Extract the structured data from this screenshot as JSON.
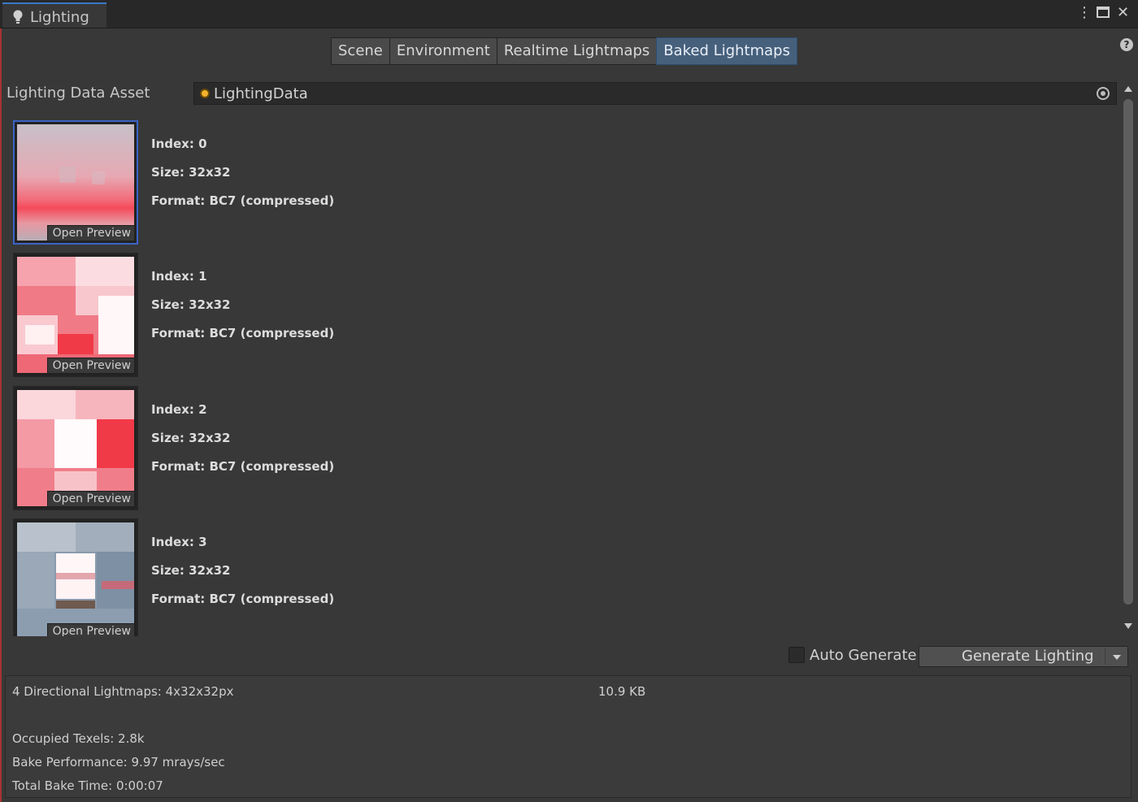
{
  "window": {
    "tab_title": "Lighting",
    "tab_icon": "lightbulb-icon",
    "controls": {
      "menu": "⋮",
      "maximize": "🗖",
      "close": "✕"
    }
  },
  "toolbar": {
    "tabs": [
      {
        "label": "Scene",
        "active": false
      },
      {
        "label": "Environment",
        "active": false
      },
      {
        "label": "Realtime Lightmaps",
        "active": false
      },
      {
        "label": "Baked Lightmaps",
        "active": true
      }
    ],
    "help": "?"
  },
  "lighting_data_asset": {
    "label": "Lighting Data Asset",
    "value": "LightingData",
    "value_icon": "lighting-data-asset-icon",
    "picker_icon": "object-picker-icon"
  },
  "lightmaps": [
    {
      "index": "Index: 0",
      "size": "Size: 32x32",
      "format": "Format: BC7 (compressed)",
      "preview": "Open Preview",
      "selected": true
    },
    {
      "index": "Index: 1",
      "size": "Size: 32x32",
      "format": "Format: BC7 (compressed)",
      "preview": "Open Preview",
      "selected": false
    },
    {
      "index": "Index: 2",
      "size": "Size: 32x32",
      "format": "Format: BC7 (compressed)",
      "preview": "Open Preview",
      "selected": false
    },
    {
      "index": "Index: 3",
      "size": "Size: 32x32",
      "format": "Format: BC7 (compressed)",
      "preview": "Open Preview",
      "selected": false
    }
  ],
  "bottom": {
    "auto_generate_label": "Auto Generate",
    "auto_generate_checked": false,
    "generate_button": "Generate Lighting"
  },
  "stats": {
    "lightmaps_summary": "4 Directional Lightmaps: 4x32x32px",
    "size": "10.9 KB",
    "occupied_texels": "Occupied Texels: 2.8k",
    "bake_performance": "Bake Performance: 9.97 mrays/sec",
    "total_bake_time": "Total Bake Time: 0:00:07"
  },
  "colors": {
    "accent": "#3b64c8",
    "active_tab": "#46607c",
    "panel": "#383838",
    "lightmap_pink": "#f07a86",
    "lightmap_red": "#f03a48"
  }
}
